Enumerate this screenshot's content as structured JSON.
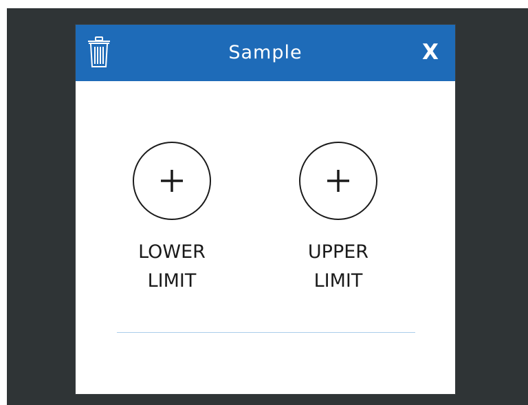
{
  "dialog": {
    "title": "Sample",
    "close_label": "X",
    "delete_icon": "trash-icon"
  },
  "limits": {
    "lower": {
      "icon": "plus-icon",
      "line1": "LOWER",
      "line2": "LIMIT"
    },
    "upper": {
      "icon": "plus-icon",
      "line1": "UPPER",
      "line2": "LIMIT"
    }
  },
  "colors": {
    "title_bar": "#1e6bb8",
    "background": "#2f3436",
    "divider": "#a9cdea"
  }
}
